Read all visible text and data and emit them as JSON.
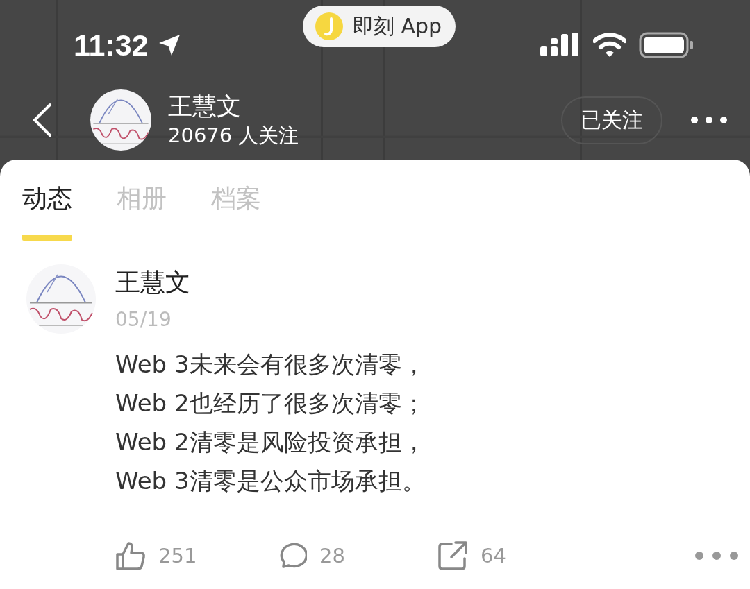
{
  "status_bar": {
    "time": "11:32",
    "app_pill": "即刻 App"
  },
  "header": {
    "name": "王慧文",
    "followers": "20676 人关注",
    "follow_button": "已关注"
  },
  "tabs": [
    {
      "label": "动态",
      "selected": true
    },
    {
      "label": "相册",
      "selected": false
    },
    {
      "label": "档案",
      "selected": false
    }
  ],
  "post": {
    "author": "王慧文",
    "date": "05/19",
    "lines": [
      "Web 3未来会有很多次清零，",
      "Web 2也经历了很多次清零；",
      "Web 2清零是风险投资承担，",
      "Web 3清零是公众市场承担。"
    ],
    "actions": [
      {
        "kind": "like",
        "count": "251"
      },
      {
        "kind": "comment",
        "count": "28"
      },
      {
        "kind": "share",
        "count": "64"
      }
    ]
  }
}
